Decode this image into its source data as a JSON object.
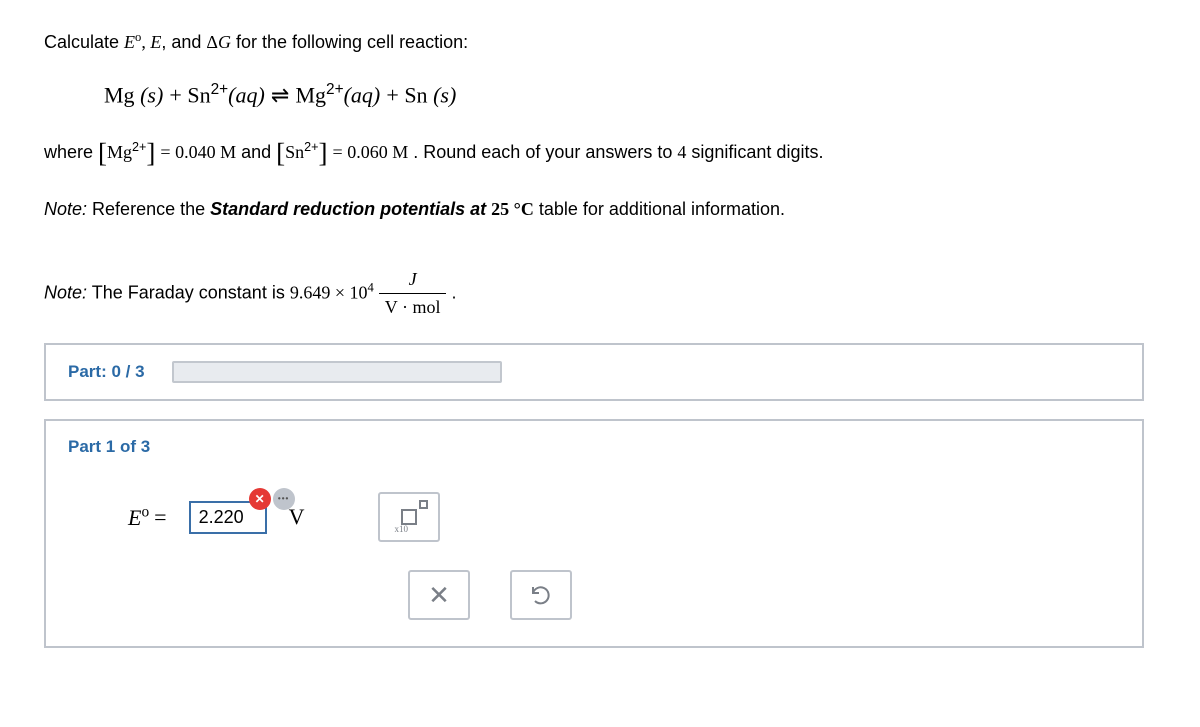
{
  "intro": {
    "prefix": "Calculate ",
    "suffix": " for the following cell reaction:"
  },
  "reaction": {
    "r1": "Mg",
    "r1_state": "(s)",
    "r2": "Sn",
    "r2_sup": "2+",
    "r2_state": "(aq)",
    "arrow": "⇌",
    "p1": "Mg",
    "p1_sup": "2+",
    "p1_state": "(aq)",
    "p2": "Sn",
    "p2_state": "(s)"
  },
  "where": {
    "prefix": "where ",
    "mg_sym": "Mg",
    "mg_sup": "2+",
    "mg_eq": " = ",
    "mg_val": "0.040 M",
    "and": " and ",
    "sn_sym": "Sn",
    "sn_sup": "2+",
    "sn_eq": " = ",
    "sn_val": "0.060 M",
    "suffix": ". Round each of your answers to ",
    "sig": "4",
    "suffix2": " significant digits."
  },
  "note1": {
    "prefix": "Note:",
    "body1": " Reference the ",
    "bold": "Standard reduction potentials at ",
    "temp": "25 °C",
    "body2": " table for additional information."
  },
  "note2": {
    "prefix": "Note:",
    "body": " The Faraday constant is ",
    "val": "9.649 × 10",
    "exp": "4",
    "frac_num": "J",
    "frac_den": "V · mol",
    "period": "."
  },
  "progress": {
    "label": "Part: 0 / 3"
  },
  "part1": {
    "title": "Part 1 of 3",
    "lhs_sym": "E",
    "lhs_sup": "o",
    "eq": " = ",
    "value": "2.220",
    "unit": "V",
    "sci_label": "x10"
  }
}
